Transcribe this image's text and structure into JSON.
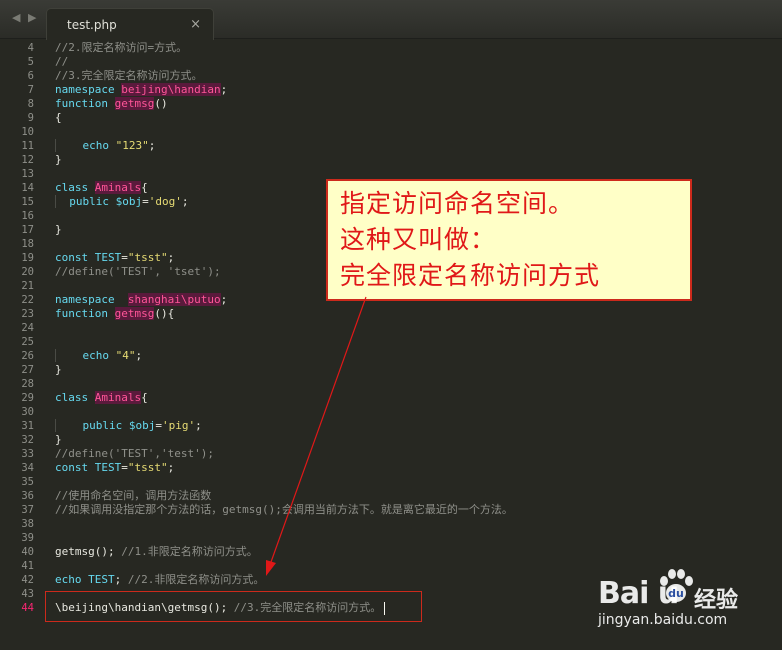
{
  "tab": {
    "title": "test.php",
    "close": "×"
  },
  "nav": {
    "back": "◀",
    "forward": "▶"
  },
  "lines": [
    {
      "n": "4",
      "t": "//2.限定名称访问=方式。"
    },
    {
      "n": "5",
      "t": "//"
    },
    {
      "n": "6",
      "t": "//3.完全限定名称访问方式。"
    },
    {
      "n": "7",
      "kw": "namespace",
      "sp": " ",
      "name": "beijing\\handian",
      "end": ";"
    },
    {
      "n": "8",
      "kw": "function",
      "sp": " ",
      "fn": "getmsg",
      "end": "()"
    },
    {
      "n": "9",
      "t": "{"
    },
    {
      "n": "10",
      "t": ""
    },
    {
      "n": "11",
      "pre": "    ",
      "kw2": "echo",
      "sp": " ",
      "str": "\"123\"",
      "end": ";"
    },
    {
      "n": "12",
      "t": "}"
    },
    {
      "n": "13",
      "t": ""
    },
    {
      "n": "14",
      "kw": "class",
      "sp": " ",
      "name": "Aminals",
      "end": "{"
    },
    {
      "n": "15",
      "pre": "  ",
      "kw2": "public",
      "sp": " ",
      "var": "$obj",
      "eq": "=",
      "str": "'dog'",
      "end": ";"
    },
    {
      "n": "16",
      "t": ""
    },
    {
      "n": "17",
      "t": "}"
    },
    {
      "n": "18",
      "t": ""
    },
    {
      "n": "19",
      "kw": "const",
      "sp": " ",
      "const": "TEST",
      "eq": "=",
      "str": "\"tsst\"",
      "end": ";"
    },
    {
      "n": "20",
      "t": "//define('TEST', 'tset');"
    },
    {
      "n": "21",
      "t": ""
    },
    {
      "n": "22",
      "kw": "namespace",
      "sp": "  ",
      "name": "shanghai\\putuo",
      "end": ";"
    },
    {
      "n": "23",
      "kw": "function",
      "sp": " ",
      "fn": "getmsg",
      "end": "(){"
    },
    {
      "n": "24",
      "t": ""
    },
    {
      "n": "25",
      "t": ""
    },
    {
      "n": "26",
      "pre": "    ",
      "kw2": "echo",
      "sp": " ",
      "str": "\"4\"",
      "end": ";"
    },
    {
      "n": "27",
      "t": "}"
    },
    {
      "n": "28",
      "t": ""
    },
    {
      "n": "29",
      "kw": "class",
      "sp": " ",
      "name": "Aminals",
      "end": "{"
    },
    {
      "n": "30",
      "t": ""
    },
    {
      "n": "31",
      "pre": "    ",
      "kw2": "public",
      "sp": " ",
      "var": "$obj",
      "eq": "=",
      "str": "'pig'",
      "end": ";"
    },
    {
      "n": "32",
      "t": "}"
    },
    {
      "n": "33",
      "t": "//define('TEST','test');"
    },
    {
      "n": "34",
      "kw": "const",
      "sp": " ",
      "const": "TEST",
      "eq": "=",
      "str": "\"tsst\"",
      "end": ";"
    },
    {
      "n": "35",
      "t": ""
    },
    {
      "n": "36",
      "t": "//使用命名空间，调用方法函数"
    },
    {
      "n": "37",
      "t": "//如果调用没指定那个方法的话，getmsg();会调用当前方法下。就是离它最近的一个方法。"
    },
    {
      "n": "38",
      "t": ""
    },
    {
      "n": "39",
      "t": ""
    },
    {
      "n": "40",
      "code": "getmsg();",
      "cm": " //1.非限定名称访问方式。"
    },
    {
      "n": "41",
      "t": ""
    },
    {
      "n": "42",
      "kw": "echo",
      "sp": " ",
      "const": "TEST",
      "end": ";",
      "cm": " //2.非限定名称访问方式。"
    },
    {
      "n": "43",
      "t": ""
    },
    {
      "n": "44",
      "code": "\\beijing\\handian\\getmsg();",
      "cm": " //3.完全限定名称访问方式。",
      "active": true
    }
  ],
  "callout": {
    "line1": "指定访问命名空间。",
    "line2": "这种又叫做：",
    "line3": "完全限定名称访问方式"
  },
  "watermark": {
    "logo": "Bai  u",
    "cn": "经验",
    "url": "jingyan.baidu.com"
  },
  "colors": {
    "background": "#272822",
    "keyword": "#66d9ef",
    "function": "#a6e22e",
    "highlight": "#ff5599",
    "string": "#e6db74",
    "comment": "#8f908a",
    "annotation_red": "#e01818",
    "annotation_bg": "#ffffc7"
  }
}
